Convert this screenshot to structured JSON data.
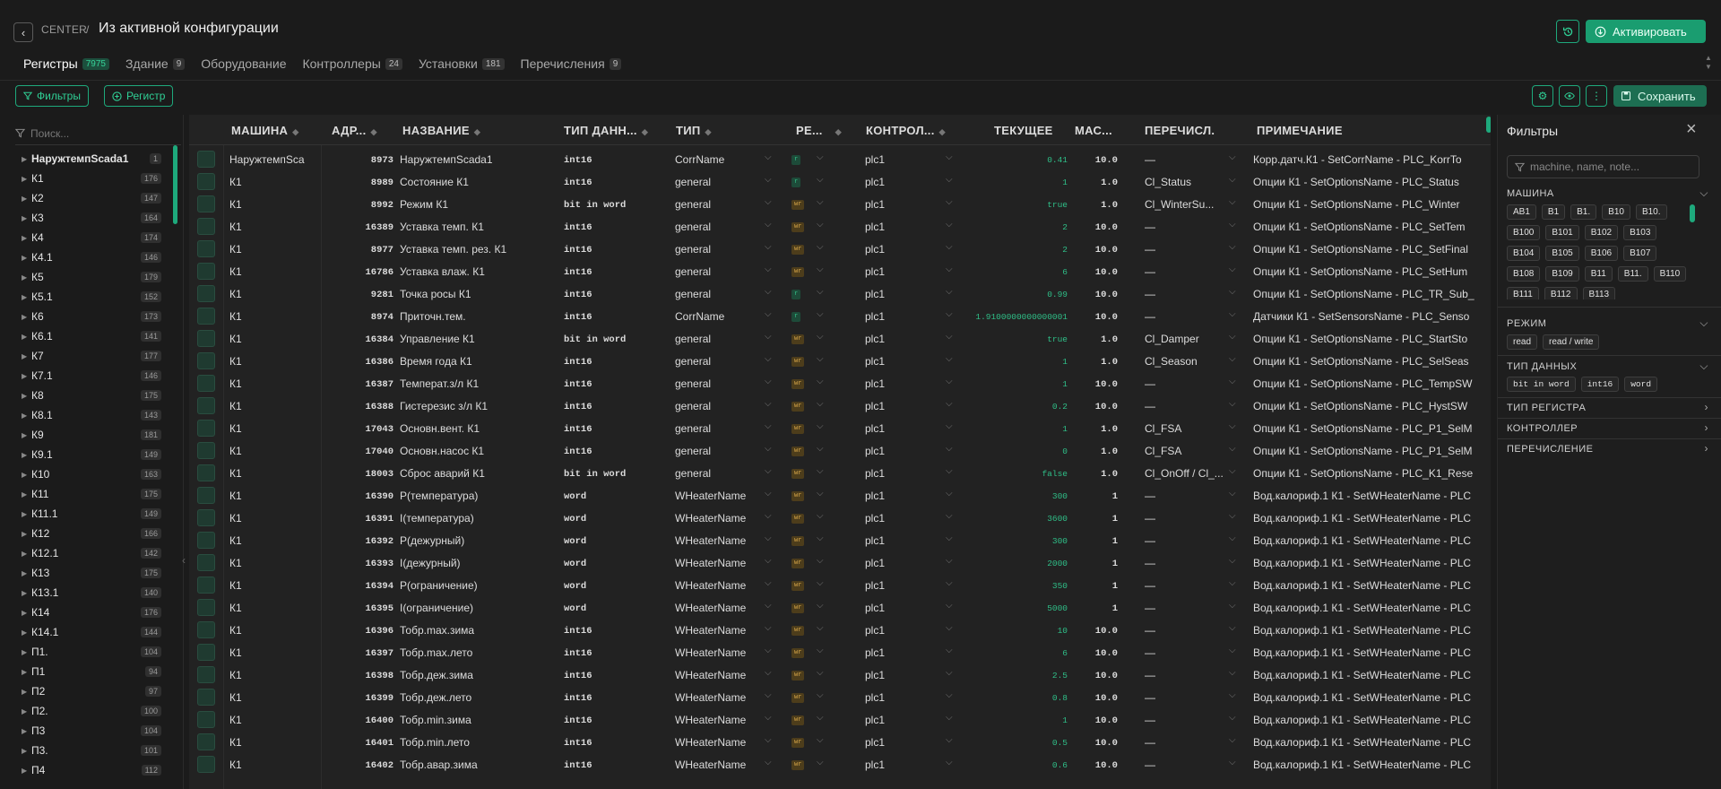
{
  "header": {
    "back_icon": "‹",
    "crumb": "CENTER",
    "separator": "/",
    "title": "Из активной конфигурации",
    "activate": "Активировать"
  },
  "tabs": [
    {
      "label": "Регистры",
      "count": "7975"
    },
    {
      "label": "Здание",
      "count": "9"
    },
    {
      "label": "Оборудование",
      "count": ""
    },
    {
      "label": "Контроллеры",
      "count": "24"
    },
    {
      "label": "Установки",
      "count": "181"
    },
    {
      "label": "Перечисления",
      "count": "9"
    }
  ],
  "toolbar": {
    "filters": "Фильтры",
    "add_register": "Регистр",
    "save": "Сохранить"
  },
  "sidebar": {
    "search_placeholder": "Поиск...",
    "items": [
      {
        "name": "НаружтемпScada1",
        "count": "1"
      },
      {
        "name": "К1",
        "count": "176"
      },
      {
        "name": "К2",
        "count": "147"
      },
      {
        "name": "К3",
        "count": "164"
      },
      {
        "name": "К4",
        "count": "174"
      },
      {
        "name": "К4.1",
        "count": "146"
      },
      {
        "name": "К5",
        "count": "179"
      },
      {
        "name": "К5.1",
        "count": "152"
      },
      {
        "name": "К6",
        "count": "173"
      },
      {
        "name": "К6.1",
        "count": "141"
      },
      {
        "name": "К7",
        "count": "177"
      },
      {
        "name": "К7.1",
        "count": "146"
      },
      {
        "name": "К8",
        "count": "175"
      },
      {
        "name": "К8.1",
        "count": "143"
      },
      {
        "name": "К9",
        "count": "181"
      },
      {
        "name": "К9.1",
        "count": "149"
      },
      {
        "name": "К10",
        "count": "163"
      },
      {
        "name": "К11",
        "count": "175"
      },
      {
        "name": "К11.1",
        "count": "149"
      },
      {
        "name": "К12",
        "count": "166"
      },
      {
        "name": "К12.1",
        "count": "142"
      },
      {
        "name": "К13",
        "count": "175"
      },
      {
        "name": "К13.1",
        "count": "140"
      },
      {
        "name": "К14",
        "count": "176"
      },
      {
        "name": "К14.1",
        "count": "144"
      },
      {
        "name": "П1.",
        "count": "104"
      },
      {
        "name": "П1",
        "count": "94"
      },
      {
        "name": "П2",
        "count": "97"
      },
      {
        "name": "П2.",
        "count": "100"
      },
      {
        "name": "П3",
        "count": "104"
      },
      {
        "name": "П3.",
        "count": "101"
      },
      {
        "name": "П4",
        "count": "112"
      }
    ]
  },
  "columns": {
    "machine": "МАШИНА",
    "address": "АДР...",
    "name": "НАЗВАНИЕ",
    "dtype": "ТИП ДАНН...",
    "type": "ТИП",
    "mode": "РЕ...",
    "controller": "КОНТРОЛ...",
    "current": "ТЕКУЩЕЕ",
    "scale": "МАС...",
    "enum": "ПЕРЕЧИСЛ.",
    "note": "ПРИМЕЧАНИЕ"
  },
  "rows": [
    {
      "machine": "НаружтемпSca",
      "addr": "8973",
      "name": "НаружтемпScada1",
      "dtype": "int16",
      "type": "CorrName",
      "mode": "r",
      "ctrl": "plc1",
      "cur": "0.41",
      "scale": "10.0",
      "enum": "—",
      "note": "Корр.датч.К1 - SetCorrName - PLC_KorrTo"
    },
    {
      "machine": "К1",
      "addr": "8989",
      "name": "Состояние К1",
      "dtype": "int16",
      "type": "general",
      "mode": "r",
      "ctrl": "plc1",
      "cur": "1",
      "scale": "1.0",
      "enum": "Cl_Status",
      "note": "Опции К1 - SetOptionsName - PLC_Status"
    },
    {
      "machine": "К1",
      "addr": "8992",
      "name": "Режим К1",
      "dtype": "bit in word",
      "type": "general",
      "mode": "wr",
      "ctrl": "plc1",
      "cur": "true",
      "scale": "1.0",
      "enum": "Cl_WinterSu...",
      "note": "Опции К1 - SetOptionsName - PLC_Winter"
    },
    {
      "machine": "К1",
      "addr": "16389",
      "name": "Уставка темп. К1",
      "dtype": "int16",
      "type": "general",
      "mode": "wr",
      "ctrl": "plc1",
      "cur": "2",
      "scale": "10.0",
      "enum": "—",
      "note": "Опции К1 - SetOptionsName - PLC_SetTem"
    },
    {
      "machine": "К1",
      "addr": "8977",
      "name": "Уставка темп. рез. К1",
      "dtype": "int16",
      "type": "general",
      "mode": "wr",
      "ctrl": "plc1",
      "cur": "2",
      "scale": "10.0",
      "enum": "—",
      "note": "Опции К1 - SetOptionsName - PLC_SetFinal"
    },
    {
      "machine": "К1",
      "addr": "16786",
      "name": "Уставка влаж. К1",
      "dtype": "int16",
      "type": "general",
      "mode": "wr",
      "ctrl": "plc1",
      "cur": "6",
      "scale": "10.0",
      "enum": "—",
      "note": "Опции К1 - SetOptionsName - PLC_SetHum"
    },
    {
      "machine": "К1",
      "addr": "9281",
      "name": "Точка росы К1",
      "dtype": "int16",
      "type": "general",
      "mode": "r",
      "ctrl": "plc1",
      "cur": "0.99",
      "scale": "10.0",
      "enum": "—",
      "note": "Опции К1 - SetOptionsName - PLC_TR_Sub_"
    },
    {
      "machine": "К1",
      "addr": "8974",
      "name": "Приточн.тем.",
      "dtype": "int16",
      "type": "CorrName",
      "mode": "r",
      "ctrl": "plc1",
      "cur": "1.9100000000000001",
      "scale": "10.0",
      "enum": "—",
      "note": "Датчики К1 - SetSensorsName - PLC_Senso"
    },
    {
      "machine": "К1",
      "addr": "16384",
      "name": "Управление К1",
      "dtype": "bit in word",
      "type": "general",
      "mode": "wr",
      "ctrl": "plc1",
      "cur": "true",
      "scale": "1.0",
      "enum": "Cl_Damper",
      "note": "Опции К1 - SetOptionsName - PLC_StartSto"
    },
    {
      "machine": "К1",
      "addr": "16386",
      "name": "Время года К1",
      "dtype": "int16",
      "type": "general",
      "mode": "wr",
      "ctrl": "plc1",
      "cur": "1",
      "scale": "1.0",
      "enum": "Cl_Season",
      "note": "Опции К1 - SetOptionsName - PLC_SelSeas"
    },
    {
      "machine": "К1",
      "addr": "16387",
      "name": "Температ.з/л К1",
      "dtype": "int16",
      "type": "general",
      "mode": "wr",
      "ctrl": "plc1",
      "cur": "1",
      "scale": "10.0",
      "enum": "—",
      "note": "Опции К1 - SetOptionsName - PLC_TempSW"
    },
    {
      "machine": "К1",
      "addr": "16388",
      "name": "Гистерезис з/л К1",
      "dtype": "int16",
      "type": "general",
      "mode": "wr",
      "ctrl": "plc1",
      "cur": "0.2",
      "scale": "10.0",
      "enum": "—",
      "note": "Опции К1 - SetOptionsName - PLC_HystSW"
    },
    {
      "machine": "К1",
      "addr": "17043",
      "name": "Основн.вент. К1",
      "dtype": "int16",
      "type": "general",
      "mode": "wr",
      "ctrl": "plc1",
      "cur": "1",
      "scale": "1.0",
      "enum": "Cl_FSA",
      "note": "Опции К1 - SetOptionsName - PLC_P1_SelM"
    },
    {
      "machine": "К1",
      "addr": "17040",
      "name": "Основн.насос К1",
      "dtype": "int16",
      "type": "general",
      "mode": "wr",
      "ctrl": "plc1",
      "cur": "0",
      "scale": "1.0",
      "enum": "Cl_FSA",
      "note": "Опции К1 - SetOptionsName - PLC_P1_SelM"
    },
    {
      "machine": "К1",
      "addr": "18003",
      "name": "Сброс аварий К1",
      "dtype": "bit in word",
      "type": "general",
      "mode": "wr",
      "ctrl": "plc1",
      "cur": "false",
      "scale": "1.0",
      "enum": "Cl_OnOff / Cl_...",
      "note": "Опции К1 - SetOptionsName - PLC_K1_Rese"
    },
    {
      "machine": "К1",
      "addr": "16390",
      "name": "P(температура)",
      "dtype": "word",
      "type": "WHeaterName",
      "mode": "wr",
      "ctrl": "plc1",
      "cur": "300",
      "scale": "1",
      "enum": "—",
      "note": "Вод.калориф.1 К1 - SetWHeaterName - PLC"
    },
    {
      "machine": "К1",
      "addr": "16391",
      "name": "I(температура)",
      "dtype": "word",
      "type": "WHeaterName",
      "mode": "wr",
      "ctrl": "plc1",
      "cur": "3600",
      "scale": "1",
      "enum": "—",
      "note": "Вод.калориф.1 К1 - SetWHeaterName - PLC"
    },
    {
      "machine": "К1",
      "addr": "16392",
      "name": "P(дежурный)",
      "dtype": "word",
      "type": "WHeaterName",
      "mode": "wr",
      "ctrl": "plc1",
      "cur": "300",
      "scale": "1",
      "enum": "—",
      "note": "Вод.калориф.1 К1 - SetWHeaterName - PLC"
    },
    {
      "machine": "К1",
      "addr": "16393",
      "name": "I(дежурный)",
      "dtype": "word",
      "type": "WHeaterName",
      "mode": "wr",
      "ctrl": "plc1",
      "cur": "2000",
      "scale": "1",
      "enum": "—",
      "note": "Вод.калориф.1 К1 - SetWHeaterName - PLC"
    },
    {
      "machine": "К1",
      "addr": "16394",
      "name": "P(ограничение)",
      "dtype": "word",
      "type": "WHeaterName",
      "mode": "wr",
      "ctrl": "plc1",
      "cur": "350",
      "scale": "1",
      "enum": "—",
      "note": "Вод.калориф.1 К1 - SetWHeaterName - PLC"
    },
    {
      "machine": "К1",
      "addr": "16395",
      "name": "I(ограничение)",
      "dtype": "word",
      "type": "WHeaterName",
      "mode": "wr",
      "ctrl": "plc1",
      "cur": "5000",
      "scale": "1",
      "enum": "—",
      "note": "Вод.калориф.1 К1 - SetWHeaterName - PLC"
    },
    {
      "machine": "К1",
      "addr": "16396",
      "name": "Тобр.max.зима",
      "dtype": "int16",
      "type": "WHeaterName",
      "mode": "wr",
      "ctrl": "plc1",
      "cur": "10",
      "scale": "10.0",
      "enum": "—",
      "note": "Вод.калориф.1 К1 - SetWHeaterName - PLC"
    },
    {
      "machine": "К1",
      "addr": "16397",
      "name": "Тобр.max.лето",
      "dtype": "int16",
      "type": "WHeaterName",
      "mode": "wr",
      "ctrl": "plc1",
      "cur": "6",
      "scale": "10.0",
      "enum": "—",
      "note": "Вод.калориф.1 К1 - SetWHeaterName - PLC"
    },
    {
      "machine": "К1",
      "addr": "16398",
      "name": "Тобр.деж.зима",
      "dtype": "int16",
      "type": "WHeaterName",
      "mode": "wr",
      "ctrl": "plc1",
      "cur": "2.5",
      "scale": "10.0",
      "enum": "—",
      "note": "Вод.калориф.1 К1 - SetWHeaterName - PLC"
    },
    {
      "machine": "К1",
      "addr": "16399",
      "name": "Тобр.деж.лето",
      "dtype": "int16",
      "type": "WHeaterName",
      "mode": "wr",
      "ctrl": "plc1",
      "cur": "0.8",
      "scale": "10.0",
      "enum": "—",
      "note": "Вод.калориф.1 К1 - SetWHeaterName - PLC"
    },
    {
      "machine": "К1",
      "addr": "16400",
      "name": "Тобр.min.зима",
      "dtype": "int16",
      "type": "WHeaterName",
      "mode": "wr",
      "ctrl": "plc1",
      "cur": "1",
      "scale": "10.0",
      "enum": "—",
      "note": "Вод.калориф.1 К1 - SetWHeaterName - PLC"
    },
    {
      "machine": "К1",
      "addr": "16401",
      "name": "Тобр.min.лето",
      "dtype": "int16",
      "type": "WHeaterName",
      "mode": "wr",
      "ctrl": "plc1",
      "cur": "0.5",
      "scale": "10.0",
      "enum": "—",
      "note": "Вод.калориф.1 К1 - SetWHeaterName - PLC"
    },
    {
      "machine": "К1",
      "addr": "16402",
      "name": "Тобр.авар.зима",
      "dtype": "int16",
      "type": "WHeaterName",
      "mode": "wr",
      "ctrl": "plc1",
      "cur": "0.6",
      "scale": "10.0",
      "enum": "—",
      "note": "Вод.калориф.1 К1 - SetWHeaterName - PLC"
    }
  ],
  "filters": {
    "title": "Фильтры",
    "search_placeholder": "machine, name, note...",
    "machine_label": "МАШИНА",
    "machines": [
      "AB1",
      "B1",
      "B1.",
      "B10",
      "B10.",
      "B100",
      "B101",
      "B102",
      "B103",
      "B104",
      "B105",
      "B106",
      "B107",
      "B108",
      "B109",
      "B11",
      "B11.",
      "B110",
      "B111",
      "B112",
      "B113"
    ],
    "mode_label": "РЕЖИМ",
    "modes": [
      "read",
      "read / write"
    ],
    "dtype_label": "ТИП ДАННЫХ",
    "dtypes": [
      "bit in word",
      "int16",
      "word"
    ],
    "regtype_label": "ТИП РЕГИСТРА",
    "controller_label": "КОНТРОЛЛЕР",
    "enum_label": "ПЕРЕЧИСЛЕНИЕ"
  },
  "colors": {
    "accent": "#1ea97c",
    "accent_text": "#2fcf95",
    "background": "#1b1b1b"
  }
}
